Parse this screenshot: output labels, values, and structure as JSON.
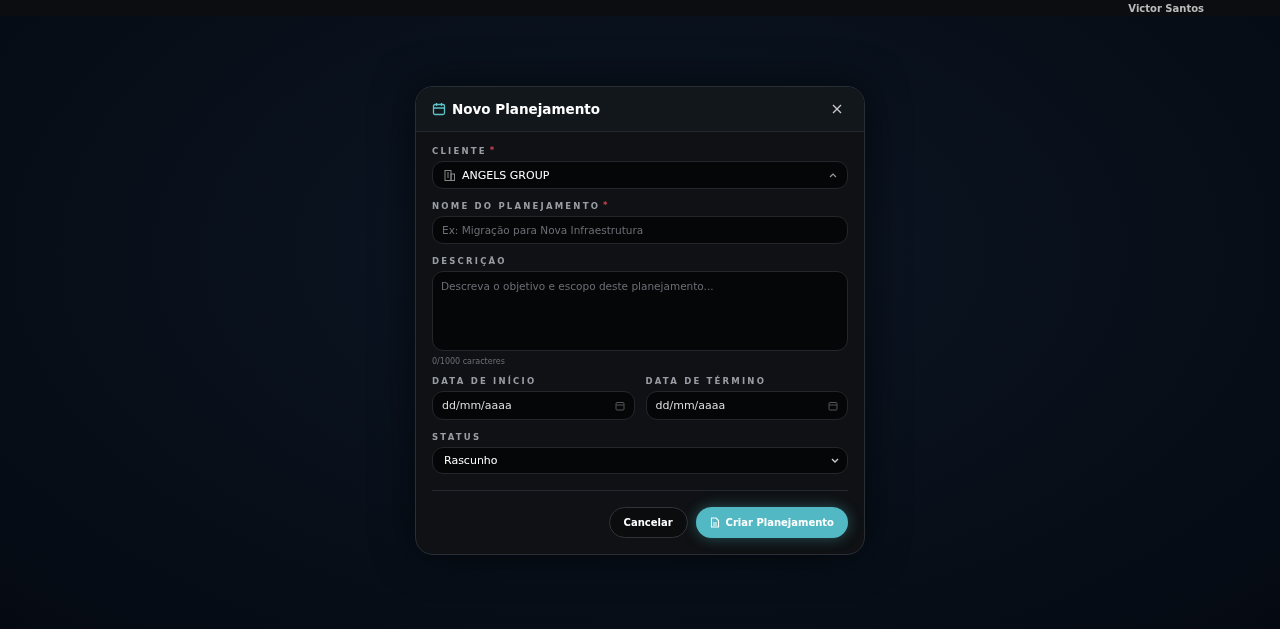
{
  "topbar": {
    "user_name": "Victor Santos"
  },
  "dialog": {
    "title": "Novo Planejamento",
    "fields": [
      {
        "kind": "select",
        "label": "CLIENTE",
        "required_mark": "*",
        "value": "ANGELS GROUP",
        "expanded": true
      },
      {
        "kind": "text",
        "label": "NOME DO PLANEJAMENTO",
        "required_mark": "*",
        "placeholder": "Ex: Migração para Nova Infraestrutura"
      },
      {
        "kind": "textarea",
        "label": "DESCRIÇÃO",
        "placeholder": "Descreva o objetivo e escopo deste planejamento...",
        "counter": "0/1000 caracteres"
      },
      {
        "kind": "dates",
        "items": [
          {
            "label": "DATA DE INÍCIO",
            "value": "dd/mm/aaaa"
          },
          {
            "label": "DATA DE TÉRMINO",
            "value": "dd/mm/aaaa"
          }
        ]
      },
      {
        "kind": "dropdown",
        "label": "STATUS",
        "value": "Rascunho"
      }
    ],
    "buttons": [
      {
        "label": "Cancelar",
        "kind": "secondary"
      },
      {
        "label": "Criar Planejamento",
        "kind": "primary"
      }
    ]
  }
}
